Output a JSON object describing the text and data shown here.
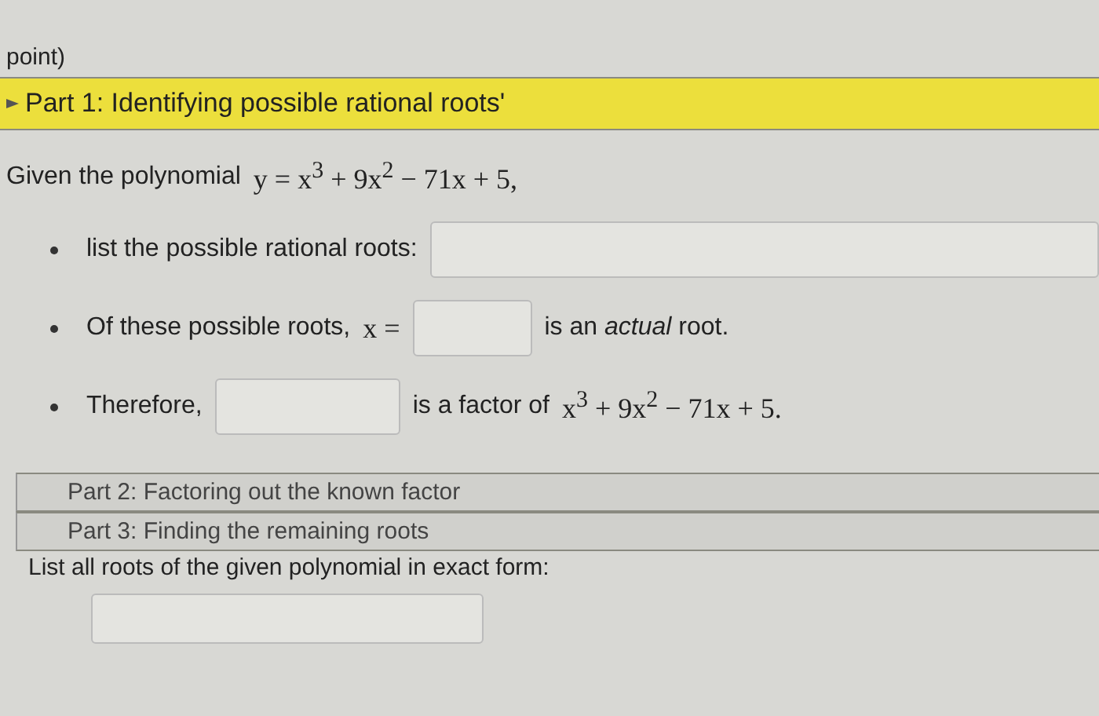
{
  "header": "point)",
  "parts": [
    {
      "title": "Part 1: Identifying possible rational roots'",
      "expanded": true,
      "intro": [
        {
          "kind": "text",
          "text": "Given the polynomial"
        },
        {
          "kind": "math",
          "text": "y = x$^{3}$ + 9x$^{2}$ − 71x + 5,"
        }
      ],
      "bullets": [
        [
          {
            "kind": "text",
            "text": "list the possible rational roots:"
          },
          {
            "kind": "wide_field"
          }
        ],
        [
          {
            "kind": "text",
            "text": "Of these possible roots,"
          },
          {
            "kind": "math",
            "text": "x ="
          },
          {
            "kind": "short_field"
          },
          {
            "kind": "text",
            "text": "is an *actual* root."
          }
        ],
        [
          {
            "kind": "text",
            "text": "Therefore,"
          },
          {
            "kind": "field"
          },
          {
            "kind": "text",
            "text": "is a factor of"
          },
          {
            "kind": "math",
            "text": "x$^{3}$ + 9x$^{2}$ − 71x + 5."
          }
        ]
      ]
    },
    {
      "title": "Part 2: Factoring out the known factor",
      "expanded": false
    },
    {
      "title": "Part 3: Finding the remaining roots",
      "expanded": false
    }
  ],
  "final": {
    "prompt": "List all roots of the given polynomial in exact form:"
  }
}
